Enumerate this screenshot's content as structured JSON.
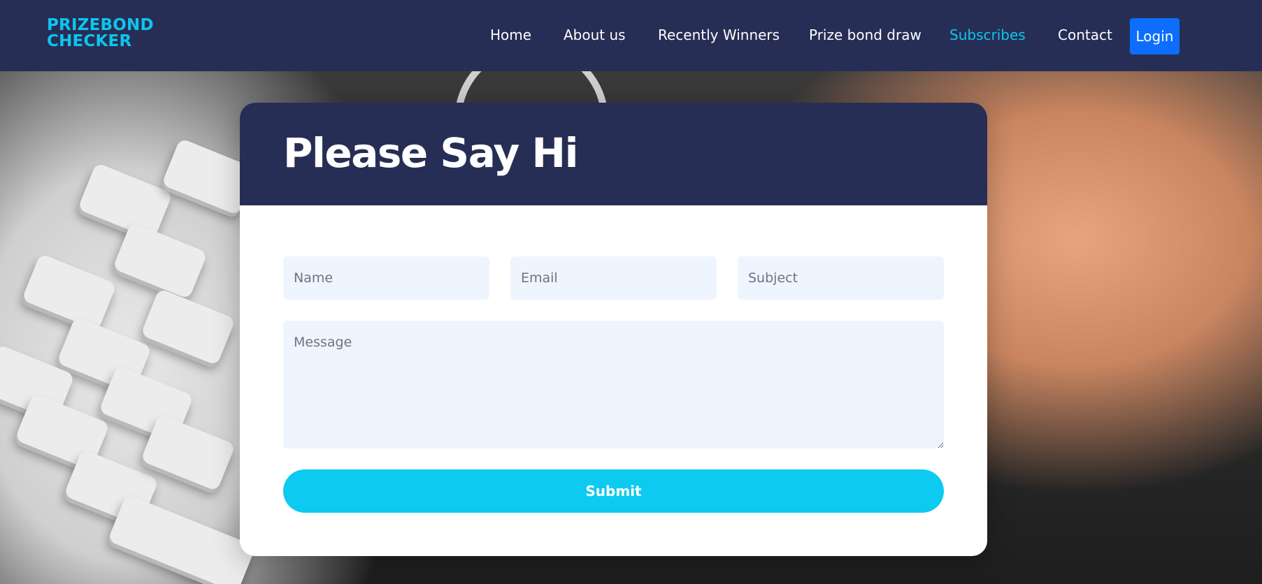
{
  "header": {
    "logo_line1": "PRIZEBOND",
    "logo_line2": "CHECKER",
    "nav": [
      {
        "label": "Home"
      },
      {
        "label": "About us"
      },
      {
        "label": "Recently Winners"
      },
      {
        "label": "Prize bond draw"
      },
      {
        "label": "Subscribes",
        "active": true
      },
      {
        "label": "Contact"
      }
    ],
    "login_label": "Login"
  },
  "form": {
    "title": "Please Say Hi",
    "name_placeholder": "Name",
    "email_placeholder": "Email",
    "subject_placeholder": "Subject",
    "message_placeholder": "Message",
    "submit_label": "Submit"
  },
  "colors": {
    "navy": "#272e55",
    "accent": "#0dc5ef",
    "login": "#0d6efd",
    "submit": "#0dcaf0",
    "field_bg": "#eef5ff"
  }
}
